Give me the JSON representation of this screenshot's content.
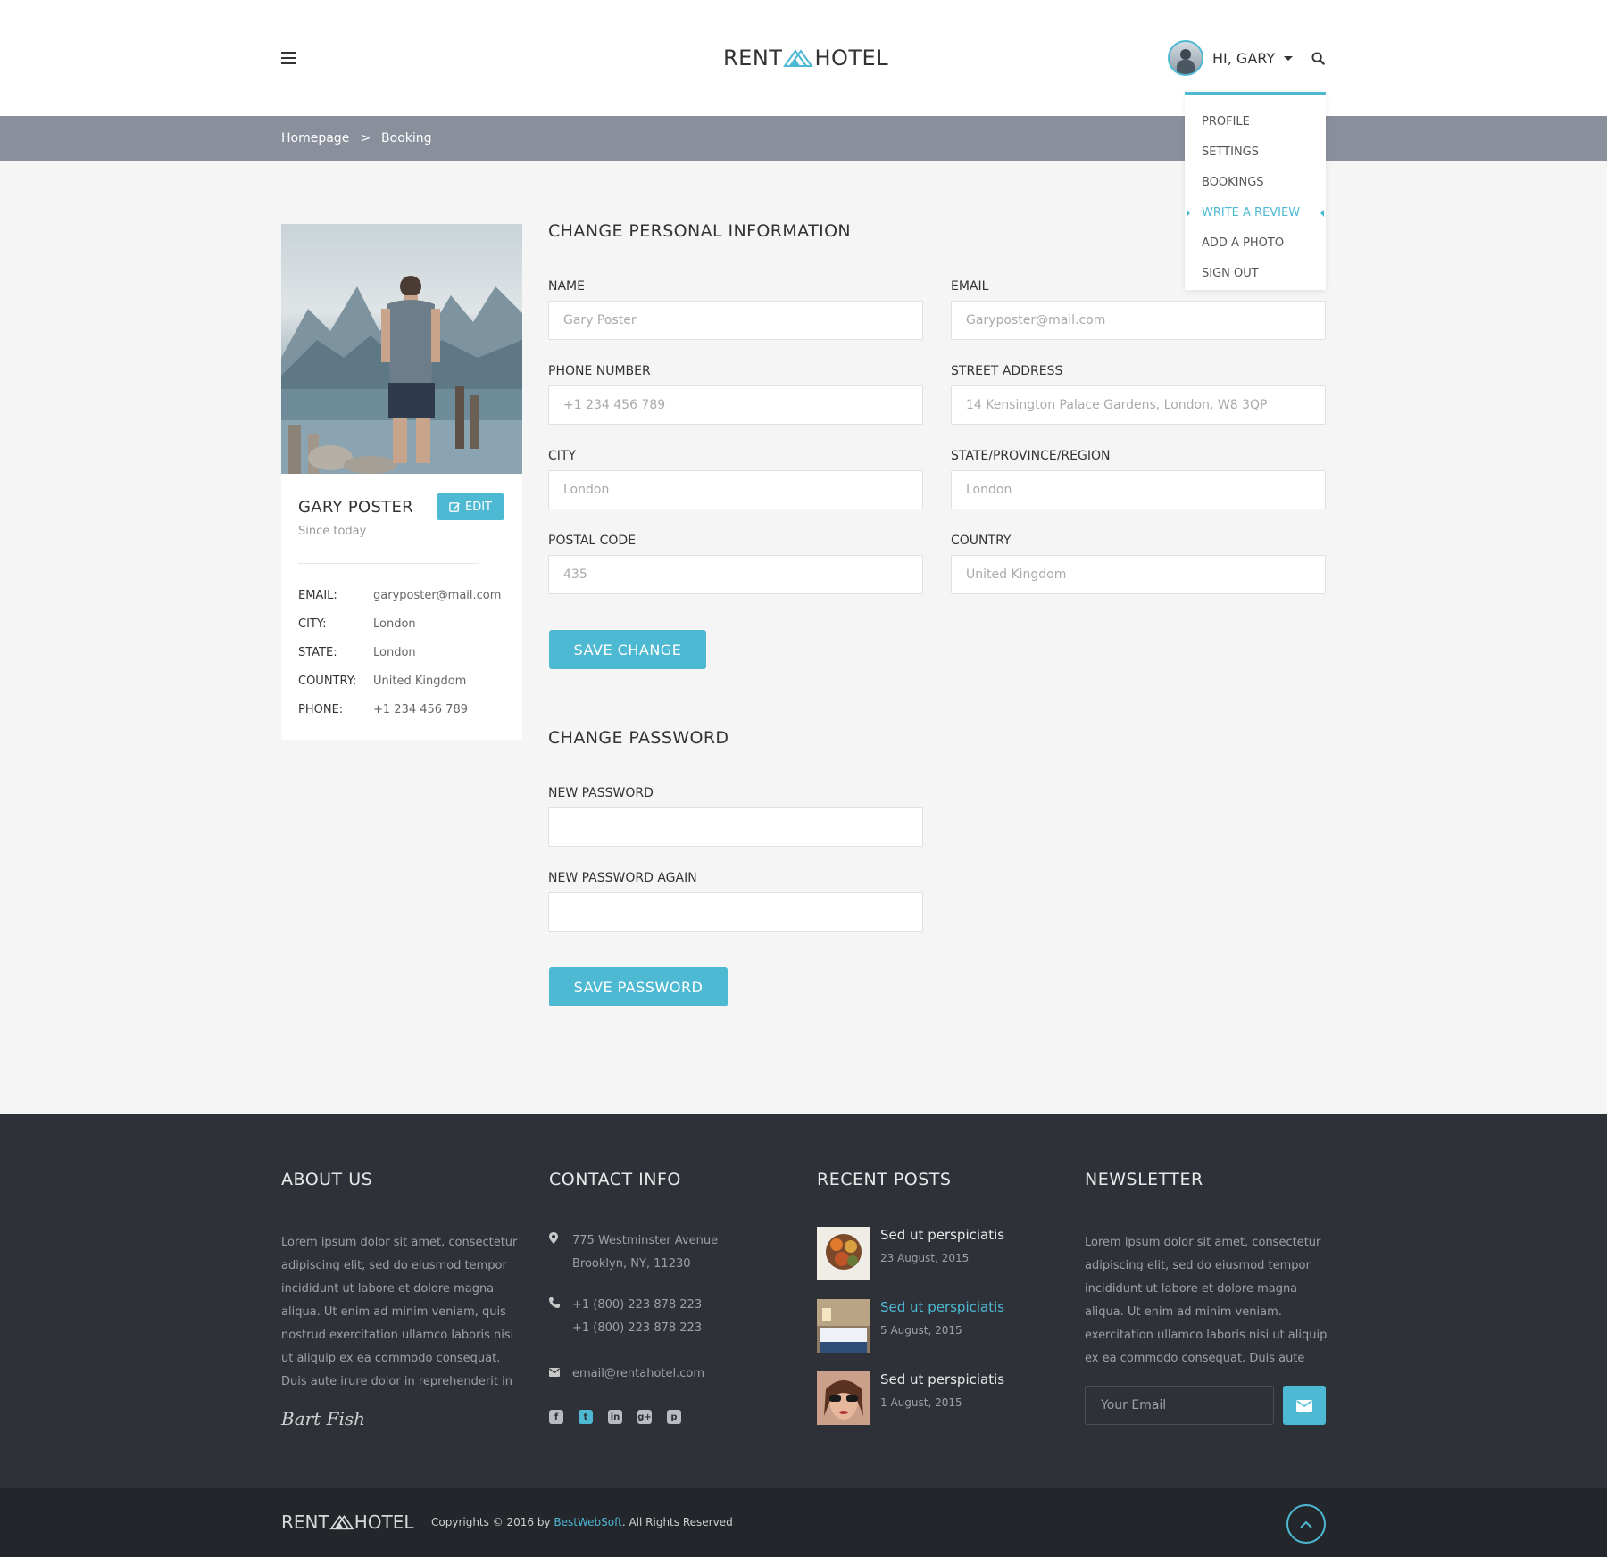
{
  "header": {
    "logo_left": "RENT",
    "logo_right": "HOTEL",
    "greeting": "HI, GARY"
  },
  "user_menu": {
    "items": [
      "PROFILE",
      "SETTINGS",
      "BOOKINGS",
      "WRITE A REVIEW",
      "ADD A PHOTO",
      "SIGN OUT"
    ],
    "active": "WRITE A REVIEW"
  },
  "breadcrumb": {
    "home": "Homepage",
    "separator": ">",
    "current": "Booking"
  },
  "profile": {
    "name": "GARY POSTER",
    "edit_label": "EDIT",
    "since": "Since today",
    "info": [
      {
        "key": "EMAIL:",
        "value": "garyposter@mail.com"
      },
      {
        "key": "CITY:",
        "value": "London"
      },
      {
        "key": "STATE:",
        "value": "London"
      },
      {
        "key": "COUNTRY:",
        "value": "United Kingdom"
      },
      {
        "key": "PHONE:",
        "value": "+1 234 456 789"
      }
    ]
  },
  "personal_form": {
    "title": "CHANGE PERSONAL INFORMATION",
    "name_label": "NAME",
    "name_value": "Gary Poster",
    "email_label": "EMAIL",
    "email_value": "Garyposter@mail.com",
    "phone_label": "PHONE NUMBER",
    "phone_value": "+1 234 456 789",
    "street_label": "STREET ADDRESS",
    "street_value": "14 Kensington Palace Gardens, London, W8 3QP",
    "city_label": "CITY",
    "city_value": "London",
    "state_label": "STATE/PROVINCE/REGION",
    "state_value": "London",
    "postal_label": "POSTAL CODE",
    "postal_value": "435",
    "country_label": "COUNTRY",
    "country_value": "United Kingdom",
    "save_label": "SAVE CHANGE"
  },
  "password_form": {
    "title": "CHANGE PASSWORD",
    "new_label": "NEW PASSWORD",
    "again_label": "NEW PASSWORD AGAIN",
    "save_label": "SAVE PASSWORD"
  },
  "footer": {
    "about_title": "ABOUT US",
    "about_text": "Lorem ipsum dolor sit amet, consectetur adipiscing elit, sed do eiusmod tempor incididunt ut labore et dolore magna aliqua. Ut enim ad minim veniam, quis nostrud exercitation ullamco laboris nisi ut aliquip ex ea commodo consequat. Duis aute irure dolor in reprehenderit in",
    "signature": "Bart Fish",
    "contact_title": "CONTACT INFO",
    "address_line1": "775 Westminster Avenue",
    "address_line2": "Brooklyn, NY, 11230",
    "phone1": "+1 (800) 223 878 223",
    "phone2": "+1 (800) 223 878 223",
    "email": "email@rentahotel.com",
    "posts_title": "RECENT POSTS",
    "posts": [
      {
        "title": "Sed ut perspiciatis",
        "date": "23 August, 2015"
      },
      {
        "title": "Sed ut perspiciatis",
        "date": "5 August, 2015"
      },
      {
        "title": "Sed ut perspiciatis",
        "date": "1 August, 2015"
      }
    ],
    "newsletter_title": "NEWSLETTER",
    "newsletter_text": "Lorem ipsum dolor sit amet, consectetur adipiscing elit, sed do eiusmod tempor incididunt ut labore et dolore magna aliqua. Ut enim ad minim veniam. exercitation ullamco laboris nisi ut aliquip ex ea commodo consequat. Duis aute",
    "email_placeholder": "Your Email"
  },
  "bottom": {
    "logo_left": "RENT",
    "logo_right": "HOTEL",
    "copyright_prefix": "Copyrights © 2016 by",
    "copyright_brand": "BestWebSoft",
    "copyright_suffix": ". All Rights Reserved"
  },
  "colors": {
    "accent": "#4eb9d3",
    "breadcrumb_bg": "#8a909b",
    "footer_bg": "#2e3238",
    "bottom_bg": "#23262b"
  },
  "icons": [
    "menu-icon",
    "logo-mountain-icon",
    "caret-down-icon",
    "search-icon",
    "edit-icon",
    "map-pin-icon",
    "phone-icon",
    "envelope-icon",
    "facebook-icon",
    "twitter-icon",
    "linkedin-icon",
    "google-plus-icon",
    "pinterest-icon",
    "chevron-up-icon"
  ]
}
